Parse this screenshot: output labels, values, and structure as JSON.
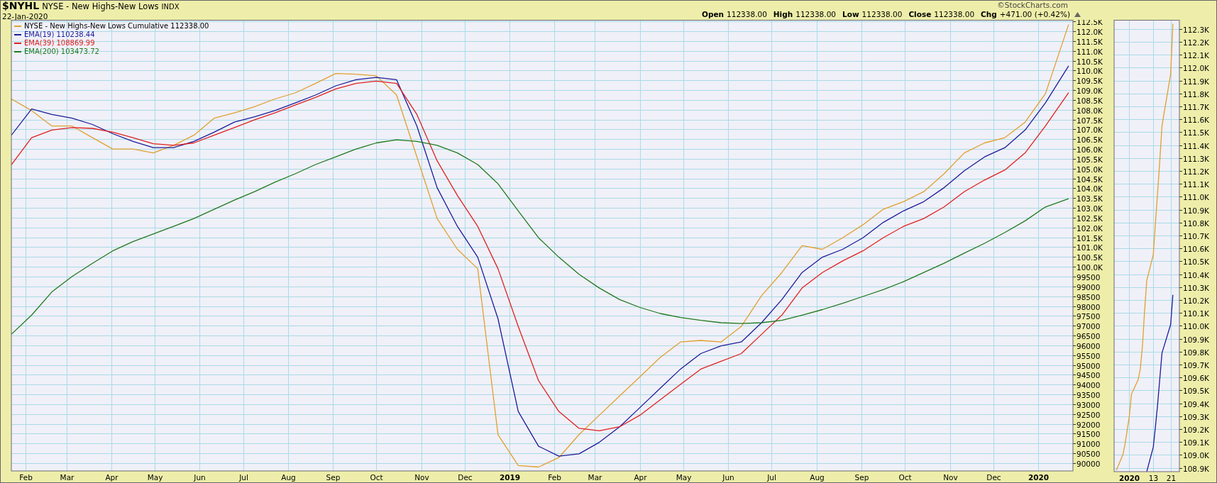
{
  "header": {
    "symbol": "$NYHL",
    "name": "NYSE - New Highs-New Lows",
    "exchange": "INDX",
    "date": "22-Jan-2020",
    "copyright": "©StockCharts.com",
    "quote": [
      {
        "label": "Open",
        "value": "112338.00"
      },
      {
        "label": "High",
        "value": "112338.00"
      },
      {
        "label": "Low",
        "value": "112338.00"
      },
      {
        "label": "Close",
        "value": "112338.00"
      },
      {
        "label": "Chg",
        "value": "+471.00 (+0.42%)"
      }
    ]
  },
  "main_chart": {
    "legend_values": [
      "112338.00",
      "110238.44",
      "108869.99",
      "103473.72"
    ],
    "chart_data": {
      "type": "line",
      "grid": true,
      "xlim": [
        "2018-01-22",
        "2020-01-25"
      ],
      "ylim": [
        89600,
        112580
      ],
      "x": [
        "2018-01-22",
        "2018-02-05",
        "2018-02-19",
        "2018-03-05",
        "2018-03-19",
        "2018-04-02",
        "2018-04-16",
        "2018-04-30",
        "2018-05-14",
        "2018-05-28",
        "2018-06-11",
        "2018-06-25",
        "2018-07-09",
        "2018-07-23",
        "2018-08-06",
        "2018-08-20",
        "2018-09-03",
        "2018-09-17",
        "2018-10-01",
        "2018-10-15",
        "2018-10-29",
        "2018-11-12",
        "2018-11-26",
        "2018-12-10",
        "2018-12-24",
        "2019-01-07",
        "2019-01-21",
        "2019-02-04",
        "2019-02-18",
        "2019-03-04",
        "2019-03-18",
        "2019-04-01",
        "2019-04-15",
        "2019-04-29",
        "2019-05-13",
        "2019-05-27",
        "2019-06-10",
        "2019-06-24",
        "2019-07-08",
        "2019-07-22",
        "2019-08-05",
        "2019-08-19",
        "2019-09-02",
        "2019-09-16",
        "2019-09-30",
        "2019-10-14",
        "2019-10-28",
        "2019-11-11",
        "2019-11-25",
        "2019-12-09",
        "2019-12-23",
        "2020-01-06",
        "2020-01-22"
      ],
      "series": [
        {
          "name": "NYSE - New Highs-New Lows Cumulative",
          "color": "#e0a030",
          "values": [
            108550,
            107960,
            107170,
            107170,
            106580,
            106000,
            106000,
            105800,
            106190,
            106700,
            107570,
            107840,
            108160,
            108550,
            108860,
            109340,
            109850,
            109810,
            109730,
            108750,
            105600,
            102460,
            100890,
            99900,
            91450,
            89880,
            89800,
            90280,
            91450,
            92440,
            93420,
            94400,
            95380,
            96170,
            96250,
            96170,
            96960,
            98530,
            99710,
            101080,
            100890,
            101480,
            102140,
            102930,
            103320,
            103830,
            104740,
            105800,
            106310,
            106580,
            107370,
            108820,
            112340
          ]
        },
        {
          "name": "EMA(19)",
          "color": "#1c1c99",
          "values": [
            106700,
            108040,
            107760,
            107570,
            107250,
            106780,
            106390,
            106070,
            106070,
            106390,
            106860,
            107370,
            107640,
            107960,
            108350,
            108750,
            109220,
            109530,
            109650,
            109530,
            107170,
            104030,
            102060,
            100490,
            97350,
            92630,
            90860,
            90350,
            90470,
            91060,
            91850,
            92830,
            93810,
            94790,
            95580,
            95970,
            96170,
            97150,
            98330,
            99710,
            100490,
            100890,
            101480,
            102260,
            102850,
            103320,
            104030,
            104890,
            105600,
            106070,
            106970,
            108350,
            110240
          ]
        },
        {
          "name": "EMA(39)",
          "color": "#e02020",
          "values": [
            105200,
            106580,
            106970,
            107090,
            107050,
            106860,
            106580,
            106270,
            106190,
            106310,
            106700,
            107090,
            107490,
            107840,
            108240,
            108630,
            109060,
            109340,
            109460,
            109340,
            107760,
            105400,
            103630,
            102060,
            99900,
            96960,
            94200,
            92630,
            91770,
            91650,
            91850,
            92440,
            93220,
            94010,
            94790,
            95190,
            95580,
            96560,
            97540,
            98920,
            99710,
            100300,
            100810,
            101480,
            102060,
            102460,
            103050,
            103830,
            104420,
            104930,
            105800,
            107170,
            108870
          ]
        },
        {
          "name": "EMA(200)",
          "color": "#1f7a1f",
          "values": [
            96560,
            97540,
            98720,
            99510,
            100180,
            100810,
            101280,
            101670,
            102060,
            102460,
            102930,
            103400,
            103830,
            104310,
            104740,
            105210,
            105600,
            106000,
            106310,
            106470,
            106390,
            106190,
            105800,
            105210,
            104230,
            102850,
            101480,
            100490,
            99620,
            98920,
            98330,
            97930,
            97620,
            97420,
            97270,
            97150,
            97110,
            97150,
            97270,
            97540,
            97820,
            98140,
            98490,
            98840,
            99240,
            99710,
            100180,
            100700,
            101200,
            101750,
            102340,
            103050,
            103470
          ]
        }
      ],
      "xticks": [
        {
          "value": "2018-02-01",
          "label": "Feb"
        },
        {
          "value": "2018-03-01",
          "label": "Mar"
        },
        {
          "value": "2018-04-01",
          "label": "Apr"
        },
        {
          "value": "2018-05-01",
          "label": "May"
        },
        {
          "value": "2018-06-01",
          "label": "Jun"
        },
        {
          "value": "2018-07-01",
          "label": "Jul"
        },
        {
          "value": "2018-08-01",
          "label": "Aug"
        },
        {
          "value": "2018-09-01",
          "label": "Sep"
        },
        {
          "value": "2018-10-01",
          "label": "Oct"
        },
        {
          "value": "2018-11-01",
          "label": "Nov"
        },
        {
          "value": "2018-12-01",
          "label": "Dec"
        },
        {
          "value": "2019-01-01",
          "label": "2019"
        },
        {
          "value": "2019-02-01",
          "label": "Feb"
        },
        {
          "value": "2019-03-01",
          "label": "Mar"
        },
        {
          "value": "2019-04-01",
          "label": "Apr"
        },
        {
          "value": "2019-05-01",
          "label": "May"
        },
        {
          "value": "2019-06-01",
          "label": "Jun"
        },
        {
          "value": "2019-07-01",
          "label": "Jul"
        },
        {
          "value": "2019-08-01",
          "label": "Aug"
        },
        {
          "value": "2019-09-01",
          "label": "Sep"
        },
        {
          "value": "2019-10-01",
          "label": "Oct"
        },
        {
          "value": "2019-11-01",
          "label": "Nov"
        },
        {
          "value": "2019-12-01",
          "label": "Dec"
        },
        {
          "value": "2020-01-01",
          "label": "2020"
        }
      ],
      "yticks": [
        90000,
        90500,
        91000,
        91500,
        92000,
        92500,
        93000,
        93500,
        94000,
        94500,
        95000,
        95500,
        96000,
        96500,
        97000,
        97500,
        98000,
        98500,
        99000,
        99500,
        {
          "value": 100000,
          "label": "100.0K"
        },
        {
          "value": 100500,
          "label": "100.5K"
        },
        {
          "value": 101000,
          "label": "101.0K"
        },
        {
          "value": 101500,
          "label": "101.5K"
        },
        {
          "value": 102000,
          "label": "102.0K"
        },
        {
          "value": 102500,
          "label": "102.5K"
        },
        {
          "value": 103000,
          "label": "103.0K"
        },
        {
          "value": 103500,
          "label": "103.5K"
        },
        {
          "value": 104000,
          "label": "104.0K"
        },
        {
          "value": 104500,
          "label": "104.5K"
        },
        {
          "value": 105000,
          "label": "105.0K"
        },
        {
          "value": 105500,
          "label": "105.5K"
        },
        {
          "value": 106000,
          "label": "106.0K"
        },
        {
          "value": 106500,
          "label": "106.5K"
        },
        {
          "value": 107000,
          "label": "107.0K"
        },
        {
          "value": 107500,
          "label": "107.5K"
        },
        {
          "value": 108000,
          "label": "108.0K"
        },
        {
          "value": 108500,
          "label": "108.5K"
        },
        {
          "value": 109000,
          "label": "109.0K"
        },
        {
          "value": 109500,
          "label": "109.5K"
        },
        {
          "value": 110000,
          "label": "110.0K"
        },
        {
          "value": 110500,
          "label": "110.5K"
        },
        {
          "value": 111000,
          "label": "111.0K"
        },
        {
          "value": 111500,
          "label": "111.5K"
        },
        {
          "value": 112000,
          "label": "112.0K"
        },
        {
          "value": 112500,
          "label": "112.5K"
        }
      ]
    }
  },
  "mini_chart": {
    "chart_data": {
      "type": "line",
      "grid": true,
      "xlim": [
        "2019-12-26",
        "2020-01-25"
      ],
      "ylim": [
        108870,
        112370
      ],
      "x": [
        "2019-12-27",
        "2019-12-30",
        "2019-12-31",
        "2020-01-02",
        "2020-01-03",
        "2020-01-06",
        "2020-01-07",
        "2020-01-08",
        "2020-01-09",
        "2020-01-10",
        "2020-01-13",
        "2020-01-14",
        "2020-01-15",
        "2020-01-16",
        "2020-01-17",
        "2020-01-21",
        "2020-01-22"
      ],
      "series": [
        {
          "color": "#e0a030",
          "values": [
            108880,
            109000,
            109080,
            109300,
            109470,
            109580,
            109660,
            109840,
            110110,
            110350,
            110550,
            110800,
            111030,
            111280,
            111550,
            111950,
            112340
          ]
        },
        {
          "color": "#1c1c99",
          "values": [
            null,
            null,
            null,
            null,
            null,
            null,
            null,
            null,
            null,
            108870,
            109060,
            109220,
            109390,
            109590,
            109790,
            110010,
            110240
          ]
        }
      ],
      "xticks": [
        {
          "value": "2020-01-02",
          "label": "2020"
        },
        {
          "value": "2020-01-13",
          "label": "13"
        },
        {
          "value": "2020-01-21",
          "label": "21"
        }
      ],
      "yticks": [
        {
          "value": 108900,
          "label": "108.9K"
        },
        {
          "value": 109000,
          "label": "109.0K"
        },
        {
          "value": 109100,
          "label": "109.1K"
        },
        {
          "value": 109200,
          "label": "109.2K"
        },
        {
          "value": 109300,
          "label": "109.3K"
        },
        {
          "value": 109400,
          "label": "109.4K"
        },
        {
          "value": 109500,
          "label": "109.5K"
        },
        {
          "value": 109600,
          "label": "109.6K"
        },
        {
          "value": 109700,
          "label": "109.7K"
        },
        {
          "value": 109800,
          "label": "109.8K"
        },
        {
          "value": 109900,
          "label": "109.9K"
        },
        {
          "value": 110000,
          "label": "110.0K"
        },
        {
          "value": 110100,
          "label": "110.1K"
        },
        {
          "value": 110200,
          "label": "110.2K"
        },
        {
          "value": 110300,
          "label": "110.3K"
        },
        {
          "value": 110400,
          "label": "110.4K"
        },
        {
          "value": 110500,
          "label": "110.5K"
        },
        {
          "value": 110600,
          "label": "110.6K"
        },
        {
          "value": 110700,
          "label": "110.7K"
        },
        {
          "value": 110800,
          "label": "110.8K"
        },
        {
          "value": 110900,
          "label": "110.9K"
        },
        {
          "value": 111000,
          "label": "111.0K"
        },
        {
          "value": 111100,
          "label": "111.1K"
        },
        {
          "value": 111200,
          "label": "111.2K"
        },
        {
          "value": 111300,
          "label": "111.3K"
        },
        {
          "value": 111400,
          "label": "111.4K"
        },
        {
          "value": 111500,
          "label": "111.5K"
        },
        {
          "value": 111600,
          "label": "111.6K"
        },
        {
          "value": 111700,
          "label": "111.7K"
        },
        {
          "value": 111800,
          "label": "111.8K"
        },
        {
          "value": 111900,
          "label": "111.9K"
        },
        {
          "value": 112000,
          "label": "112.0K"
        },
        {
          "value": 112100,
          "label": "112.1K"
        },
        {
          "value": 112200,
          "label": "112.2K"
        },
        {
          "value": 112300,
          "label": "112.3K"
        }
      ]
    }
  }
}
